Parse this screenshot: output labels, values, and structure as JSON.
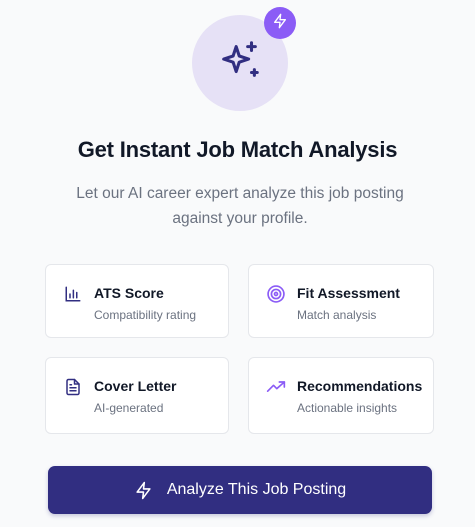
{
  "hero": {
    "icon": "sparkles-icon",
    "badge_icon": "lightning-icon",
    "badge_color": "#8b5cf6"
  },
  "heading": "Get Instant Job Match Analysis",
  "subheading": "Let our AI career expert analyze this job posting against your profile.",
  "features": [
    {
      "icon": "bar-chart-icon",
      "title": "ATS Score",
      "subtitle": "Compatibility rating"
    },
    {
      "icon": "target-icon",
      "title": "Fit Assessment",
      "subtitle": "Match analysis"
    },
    {
      "icon": "document-icon",
      "title": "Cover Letter",
      "subtitle": "AI-generated"
    },
    {
      "icon": "trending-up-icon",
      "title": "Recommendations",
      "subtitle": "Actionable insights"
    }
  ],
  "cta": {
    "label": "Analyze This Job Posting",
    "icon": "lightning-icon",
    "color": "#312e81"
  },
  "colors": {
    "accent_dark": "#312e81",
    "accent_purple": "#8b5cf6",
    "hero_bg": "#e6e1f6"
  }
}
